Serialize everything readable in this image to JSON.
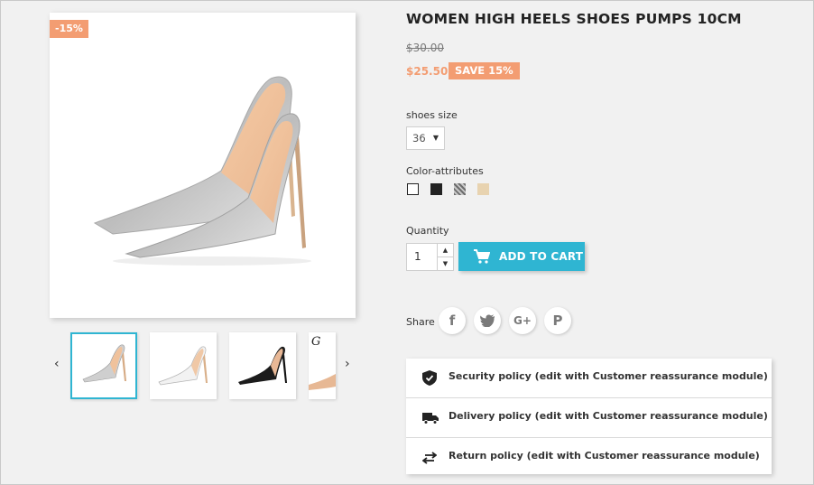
{
  "product": {
    "discount_badge": "-15%",
    "title": "WOMEN HIGH HEELS SHOES PUMPS 10CM",
    "old_price": "$30.00",
    "price": "$25.50",
    "save_badge": "SAVE 15%"
  },
  "gallery": {
    "prev_arrow": "‹",
    "next_arrow": "›",
    "thumbnails": [
      "silver-pumps",
      "white-pumps",
      "black-pumps",
      "nude-pumps"
    ],
    "selected_index": 0
  },
  "options": {
    "size_label": "shoes size",
    "size_value": "36",
    "color_label": "Color-attributes",
    "colors": [
      "#ffffff",
      "#232323",
      "#9a9a9a",
      "#e8d3b0"
    ]
  },
  "cart": {
    "quantity_label": "Quantity",
    "quantity_value": "1",
    "add_to_cart_label": "ADD TO CART"
  },
  "share": {
    "label": "Share",
    "networks": [
      "f",
      "twitter",
      "G+",
      "P"
    ]
  },
  "reassurance": [
    {
      "icon": "shield-icon",
      "text": "Security policy (edit with Customer reassurance module)"
    },
    {
      "icon": "truck-icon",
      "text": "Delivery policy (edit with Customer reassurance module)"
    },
    {
      "icon": "swap-arrows-icon",
      "text": "Return policy (edit with Customer reassurance module)"
    }
  ],
  "colors": {
    "accent": "#2fb5d2",
    "discount": "#f39d72",
    "background": "#f1f1f1"
  }
}
